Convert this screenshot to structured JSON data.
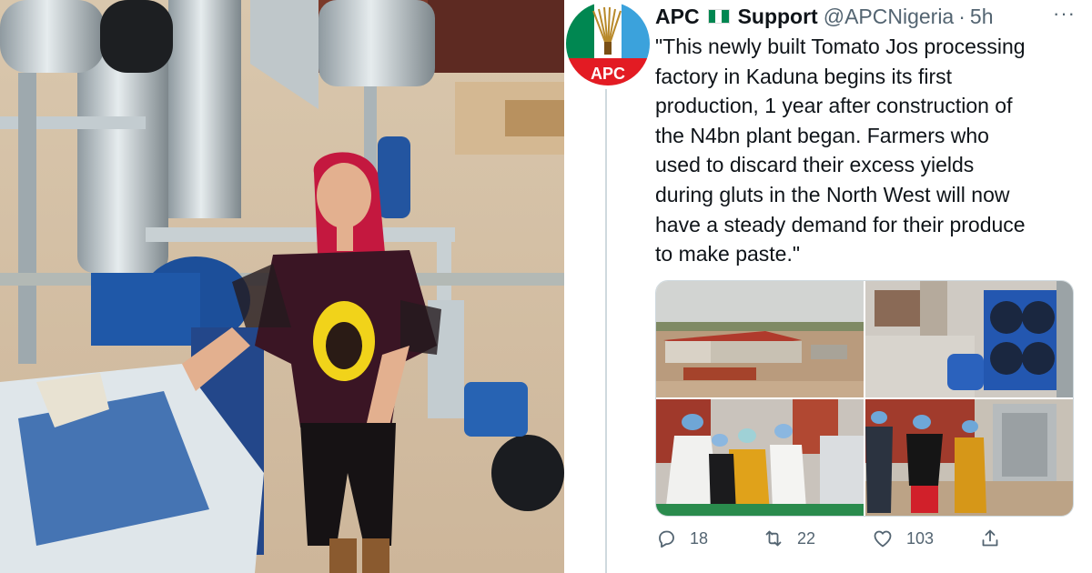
{
  "photo": {
    "alt_subject": "woman-beside-pump-machinery"
  },
  "tweet": {
    "avatar_label": "APC",
    "display_name": "APC",
    "name_suffix": "Support",
    "flag_colors": [
      "#008751",
      "#ffffff",
      "#008751"
    ],
    "handle": "@APCNigeria",
    "separator": "·",
    "time": "5h",
    "more": "···",
    "text": "\"This newly built Tomato Jos processing\nfactory in Kaduna begins its first\nproduction, 1 year after construction of\nthe N4bn plant began. Farmers who\nused to discard their excess yields\nduring gluts in the North West will now\nhave a steady demand for their produce\nto make paste.\"",
    "media": [
      {
        "name": "factory-aerial-photo"
      },
      {
        "name": "blue-machinery-photo"
      },
      {
        "name": "visitors-group-photo"
      },
      {
        "name": "factory-tour-photo"
      }
    ],
    "actions": {
      "reply_count": "18",
      "retweet_count": "22",
      "like_count": "103"
    },
    "icons": [
      "reply-icon",
      "retweet-icon",
      "like-icon",
      "share-icon"
    ]
  },
  "colors": {
    "text_primary": "#0f1419",
    "text_secondary": "#536471",
    "apc_red": "#e31b23",
    "apc_green": "#008751",
    "apc_blue": "#3ba2dc"
  }
}
